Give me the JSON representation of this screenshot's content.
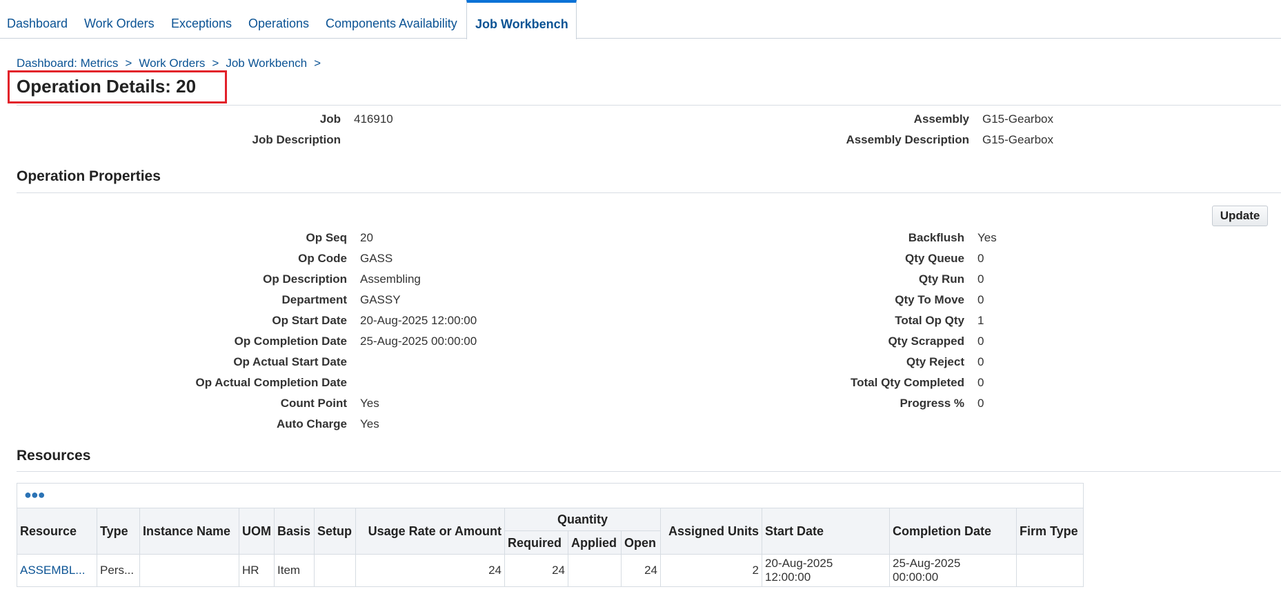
{
  "tabs": [
    {
      "label": "Dashboard",
      "active": false
    },
    {
      "label": "Work Orders",
      "active": false
    },
    {
      "label": "Exceptions",
      "active": false
    },
    {
      "label": "Operations",
      "active": false
    },
    {
      "label": "Components Availability",
      "active": false
    },
    {
      "label": "Job Workbench",
      "active": true
    }
  ],
  "breadcrumb": [
    "Dashboard: Metrics",
    "Work Orders",
    "Job Workbench"
  ],
  "breadcrumb_sep": ">",
  "page_title": "Operation Details: 20",
  "header": {
    "job_label": "Job",
    "job": "416910",
    "job_desc_label": "Job Description",
    "job_desc": "",
    "assembly_label": "Assembly",
    "assembly": "G15-Gearbox",
    "assembly_desc_label": "Assembly Description",
    "assembly_desc": "G15-Gearbox"
  },
  "op_props": {
    "heading": "Operation Properties",
    "update_label": "Update",
    "left": [
      {
        "label": "Op Seq",
        "value": "20"
      },
      {
        "label": "Op Code",
        "value": "GASS"
      },
      {
        "label": "Op Description",
        "value": "Assembling"
      },
      {
        "label": "Department",
        "value": "GASSY"
      },
      {
        "label": "Op Start Date",
        "value": "20-Aug-2025 12:00:00"
      },
      {
        "label": "Op Completion Date",
        "value": "25-Aug-2025 00:00:00"
      },
      {
        "label": "Op Actual Start Date",
        "value": ""
      },
      {
        "label": "Op Actual Completion Date",
        "value": ""
      },
      {
        "label": "Count Point",
        "value": "Yes"
      },
      {
        "label": "Auto Charge",
        "value": "Yes"
      }
    ],
    "right": [
      {
        "label": "Backflush",
        "value": "Yes"
      },
      {
        "label": "Qty Queue",
        "value": "0"
      },
      {
        "label": "Qty Run",
        "value": "0"
      },
      {
        "label": "Qty To Move",
        "value": "0"
      },
      {
        "label": "Total Op Qty",
        "value": "1"
      },
      {
        "label": "Qty Scrapped",
        "value": "0"
      },
      {
        "label": "Qty Reject",
        "value": "0"
      },
      {
        "label": "Total Qty Completed",
        "value": "0"
      },
      {
        "label": "Progress %",
        "value": "0"
      }
    ]
  },
  "resources": {
    "heading": "Resources",
    "toolbar_icon": "more-icon",
    "columns": {
      "resource": "Resource",
      "type": "Type",
      "instance": "Instance Name",
      "uom": "UOM",
      "basis": "Basis",
      "setup": "Setup",
      "usage": "Usage Rate or Amount",
      "quantity": "Quantity",
      "required": "Required",
      "applied": "Applied",
      "open": "Open",
      "assigned": "Assigned Units",
      "start": "Start Date",
      "completion": "Completion Date",
      "firm": "Firm Type"
    },
    "rows": [
      {
        "resource": "ASSEMBL...",
        "type": "Pers...",
        "instance": "",
        "uom": "HR",
        "basis": "Item",
        "setup": "",
        "usage": "24",
        "required": "24",
        "applied": "",
        "open": "24",
        "assigned": "2",
        "start": "20-Aug-2025 12:00:00",
        "completion": "25-Aug-2025 00:00:00",
        "firm": ""
      }
    ]
  }
}
